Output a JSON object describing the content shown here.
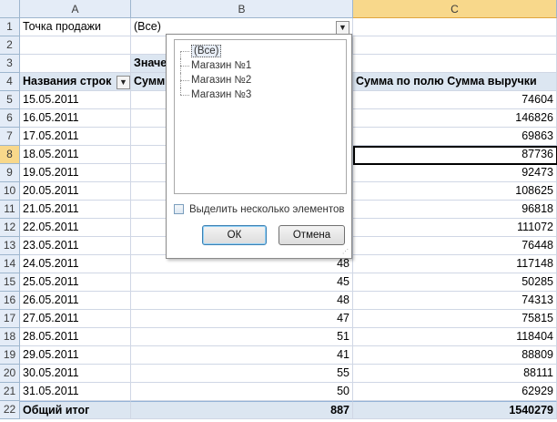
{
  "columns": {
    "a": "A",
    "b": "B",
    "c": "C"
  },
  "rows_numbers": [
    "1",
    "2",
    "3",
    "4",
    "5",
    "6",
    "7",
    "8",
    "9",
    "10",
    "11",
    "12",
    "13",
    "14",
    "15",
    "16",
    "17",
    "18",
    "19",
    "20",
    "21",
    "22"
  ],
  "filter": {
    "label": "Точка продажи",
    "value": "(Все)"
  },
  "pivot": {
    "values_header": "Значе",
    "sum_header_partial": "Сумм",
    "row_labels_header": "Названия строк",
    "revenue_header": "Сумма по полю Сумма выручки",
    "rows": [
      {
        "date": "15.05.2011",
        "count": "",
        "revenue": "74604"
      },
      {
        "date": "16.05.2011",
        "count": "",
        "revenue": "146826"
      },
      {
        "date": "17.05.2011",
        "count": "",
        "revenue": "69863"
      },
      {
        "date": "18.05.2011",
        "count": "",
        "revenue": "87736"
      },
      {
        "date": "19.05.2011",
        "count": "",
        "revenue": "92473"
      },
      {
        "date": "20.05.2011",
        "count": "",
        "revenue": "108625"
      },
      {
        "date": "21.05.2011",
        "count": "",
        "revenue": "96818"
      },
      {
        "date": "22.05.2011",
        "count": "",
        "revenue": "111072"
      },
      {
        "date": "23.05.2011",
        "count": "",
        "revenue": "76448"
      },
      {
        "date": "24.05.2011",
        "count": "48",
        "revenue": "117148"
      },
      {
        "date": "25.05.2011",
        "count": "45",
        "revenue": "50285"
      },
      {
        "date": "26.05.2011",
        "count": "48",
        "revenue": "74313"
      },
      {
        "date": "27.05.2011",
        "count": "47",
        "revenue": "75815"
      },
      {
        "date": "28.05.2011",
        "count": "51",
        "revenue": "118404"
      },
      {
        "date": "29.05.2011",
        "count": "41",
        "revenue": "88809"
      },
      {
        "date": "30.05.2011",
        "count": "55",
        "revenue": "88111"
      },
      {
        "date": "31.05.2011",
        "count": "50",
        "revenue": "62929"
      }
    ],
    "total": {
      "label": "Общий итог",
      "count": "887",
      "revenue": "1540279"
    }
  },
  "dropdown": {
    "items": [
      "(Все)",
      "Магазин №1",
      "Магазин №2",
      "Магазин №3"
    ],
    "multi_select_label": "Выделить несколько элементов",
    "ok_label": "ОК",
    "cancel_label": "Отмена"
  },
  "colors": {
    "header_bg": "#e4ecf7",
    "selected_header": "#f8d88b",
    "pivot_tint": "#dce6f1"
  }
}
